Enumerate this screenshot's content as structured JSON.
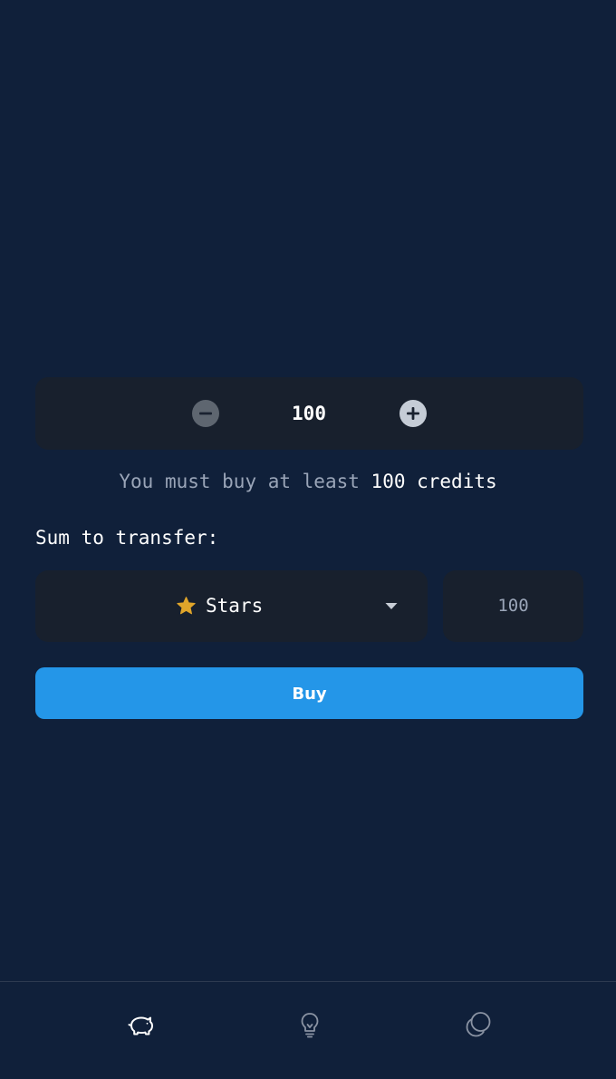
{
  "stepper": {
    "value": "100",
    "decrement_icon": "minus-circle-icon",
    "increment_icon": "plus-circle-icon"
  },
  "minimum_note": {
    "prefix": "You must buy at least",
    "amount": "100 credits"
  },
  "transfer": {
    "label": "Sum to transfer:",
    "currency": {
      "selected": "Stars",
      "icon": "star-icon"
    },
    "amount": "100"
  },
  "buy_button": {
    "label": "Buy"
  },
  "nav": {
    "items": [
      {
        "icon": "piggy-bank-icon",
        "active": true
      },
      {
        "icon": "lightbulb-icon",
        "active": false
      },
      {
        "icon": "overlapping-circles-icon",
        "active": false
      }
    ]
  },
  "colors": {
    "background": "#10203a",
    "card": "#18202d",
    "accent": "#2496e8",
    "muted_text": "#9aa5b8",
    "star": "#e0a52a"
  }
}
